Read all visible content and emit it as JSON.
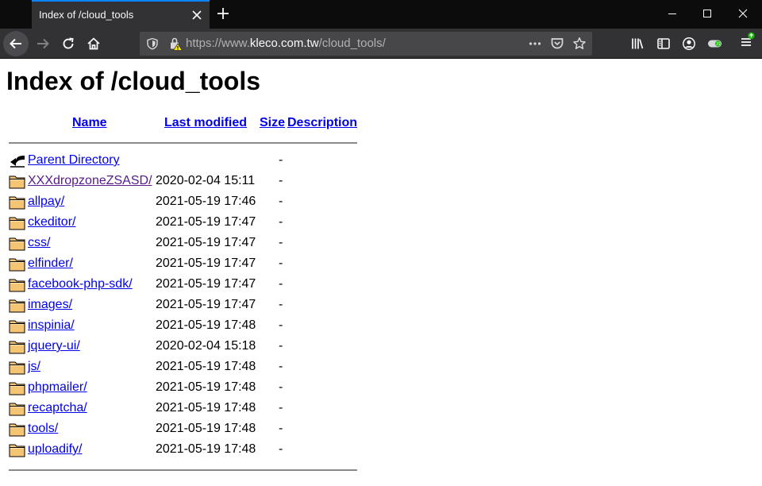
{
  "browser": {
    "tab_title": "Index of /cloud_tools",
    "url_prefix": "https://www.",
    "url_host": "kleco.com.tw",
    "url_path": "/cloud_tools/"
  },
  "page": {
    "heading": "Index of /cloud_tools",
    "columns": {
      "name": "Name",
      "last_modified": "Last modified",
      "size": "Size",
      "description": "Description"
    },
    "rows": [
      {
        "name": "Parent Directory",
        "date": "",
        "size": "-",
        "icon": "back-arrow-icon"
      },
      {
        "name": "XXXdropzoneZSASD/",
        "date": "2020-02-04 15:11",
        "size": "-",
        "icon": "folder-icon",
        "visited": true
      },
      {
        "name": "allpay/",
        "date": "2021-05-19 17:46",
        "size": "-",
        "icon": "folder-icon"
      },
      {
        "name": "ckeditor/",
        "date": "2021-05-19 17:47",
        "size": "-",
        "icon": "folder-icon"
      },
      {
        "name": "css/",
        "date": "2021-05-19 17:47",
        "size": "-",
        "icon": "folder-icon"
      },
      {
        "name": "elfinder/",
        "date": "2021-05-19 17:47",
        "size": "-",
        "icon": "folder-icon"
      },
      {
        "name": "facebook-php-sdk/",
        "date": "2021-05-19 17:47",
        "size": "-",
        "icon": "folder-icon"
      },
      {
        "name": "images/",
        "date": "2021-05-19 17:47",
        "size": "-",
        "icon": "folder-icon"
      },
      {
        "name": "inspinia/",
        "date": "2021-05-19 17:48",
        "size": "-",
        "icon": "folder-icon"
      },
      {
        "name": "jquery-ui/",
        "date": "2020-02-04 15:18",
        "size": "-",
        "icon": "folder-icon"
      },
      {
        "name": "js/",
        "date": "2021-05-19 17:48",
        "size": "-",
        "icon": "folder-icon"
      },
      {
        "name": "phpmailer/",
        "date": "2021-05-19 17:48",
        "size": "-",
        "icon": "folder-icon"
      },
      {
        "name": "recaptcha/",
        "date": "2021-05-19 17:48",
        "size": "-",
        "icon": "folder-icon"
      },
      {
        "name": "tools/",
        "date": "2021-05-19 17:48",
        "size": "-",
        "icon": "folder-icon"
      },
      {
        "name": "uploadify/",
        "date": "2021-05-19 17:48",
        "size": "-",
        "icon": "folder-icon"
      }
    ]
  },
  "colors": {
    "link": "#0000ee",
    "visited_link": "#551a8b",
    "folder_fill": "#f6c574",
    "tab_accent": "#0a84ff"
  }
}
